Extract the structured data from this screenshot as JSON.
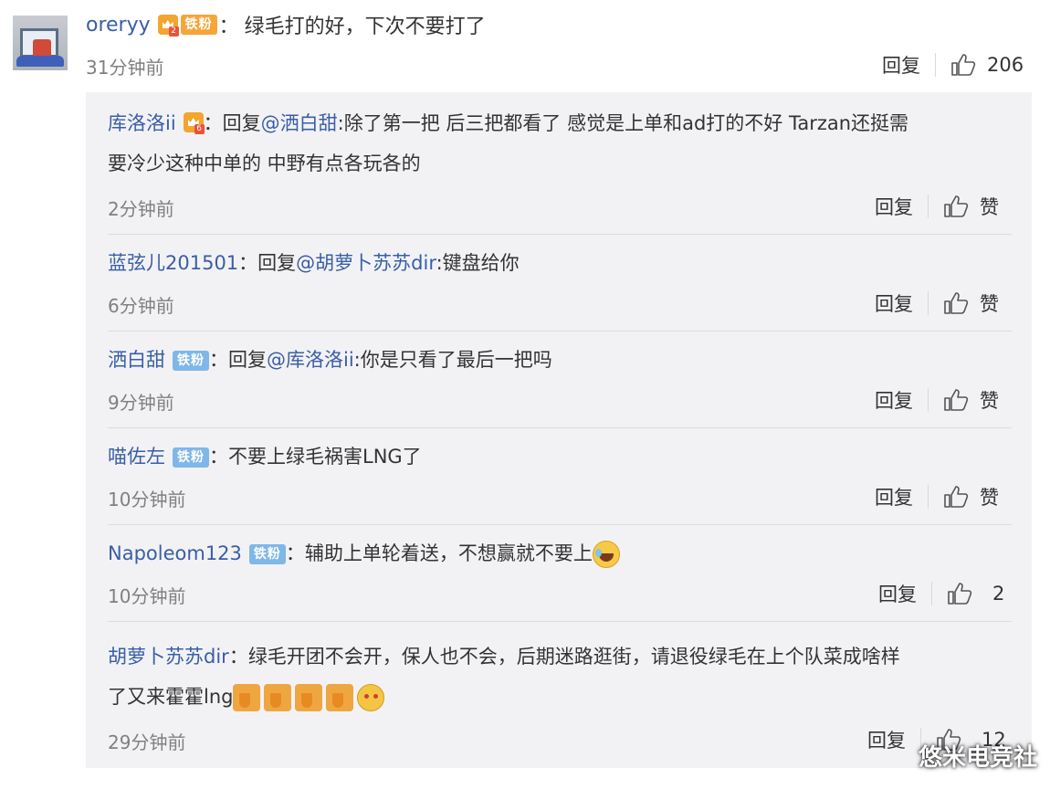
{
  "main_comment": {
    "username": "oreryy",
    "vip_level": "2",
    "badge": "铁粉",
    "text": "绿毛打的好，下次不要打了",
    "time": "31分钟前",
    "reply_label": "回复",
    "likes": "206"
  },
  "replies": [
    {
      "username": "库洛洛ii",
      "vip_level": "6",
      "reply_prefix": "回复",
      "mention": "@洒白甜",
      "text_line1": ":除了第一把 后三把都看了 感觉是上单和ad打的不好 Tarzan还挺需",
      "text_line2": "要冷少这种中单的 中野有点各玩各的",
      "time": "2分钟前",
      "reply_label": "回复",
      "like_label": "赞"
    },
    {
      "username": "蓝弦儿201501",
      "reply_prefix": "回复",
      "mention": "@胡萝卜苏苏dir",
      "text": ":键盘给你",
      "time": "6分钟前",
      "reply_label": "回复",
      "like_label": "赞"
    },
    {
      "username": "洒白甜",
      "badge": "铁粉",
      "reply_prefix": "回复",
      "mention": "@库洛洛ii",
      "text": ":你是只看了最后一把吗",
      "time": "9分钟前",
      "reply_label": "回复",
      "like_label": "赞"
    },
    {
      "username": "喵佐左",
      "badge": "铁粉",
      "text": "不要上绿毛祸害LNG了",
      "time": "10分钟前",
      "reply_label": "回复",
      "like_label": "赞"
    },
    {
      "username": "Napoleom123",
      "badge": "铁粉",
      "text": "辅助上单轮着送，不想赢就不要上",
      "emoji": "laugh-cry-icon",
      "time": "10分钟前",
      "reply_label": "回复",
      "likes": "2"
    },
    {
      "username": "胡萝卜苏苏dir",
      "text_line1": "绿毛开团不会开，保人也不会，后期迷路逛街，请退役绿毛在上个队菜成啥样",
      "text_line2": "了又来霍霍lng",
      "emojis": [
        "thumbs-down-icon",
        "thumbs-down-icon",
        "thumbs-down-icon",
        "thumbs-down-icon",
        "dog-face-icon"
      ],
      "time": "29分钟前",
      "reply_label": "回复",
      "likes": "12"
    }
  ],
  "watermark": "悠米电竞社",
  "colors": {
    "username": "#3a5ea6",
    "text": "#333333",
    "time": "#808080",
    "reply_bg": "#f2f2f5",
    "badge_orange": "#f4a63a",
    "badge_blue": "#7fb7e8"
  }
}
